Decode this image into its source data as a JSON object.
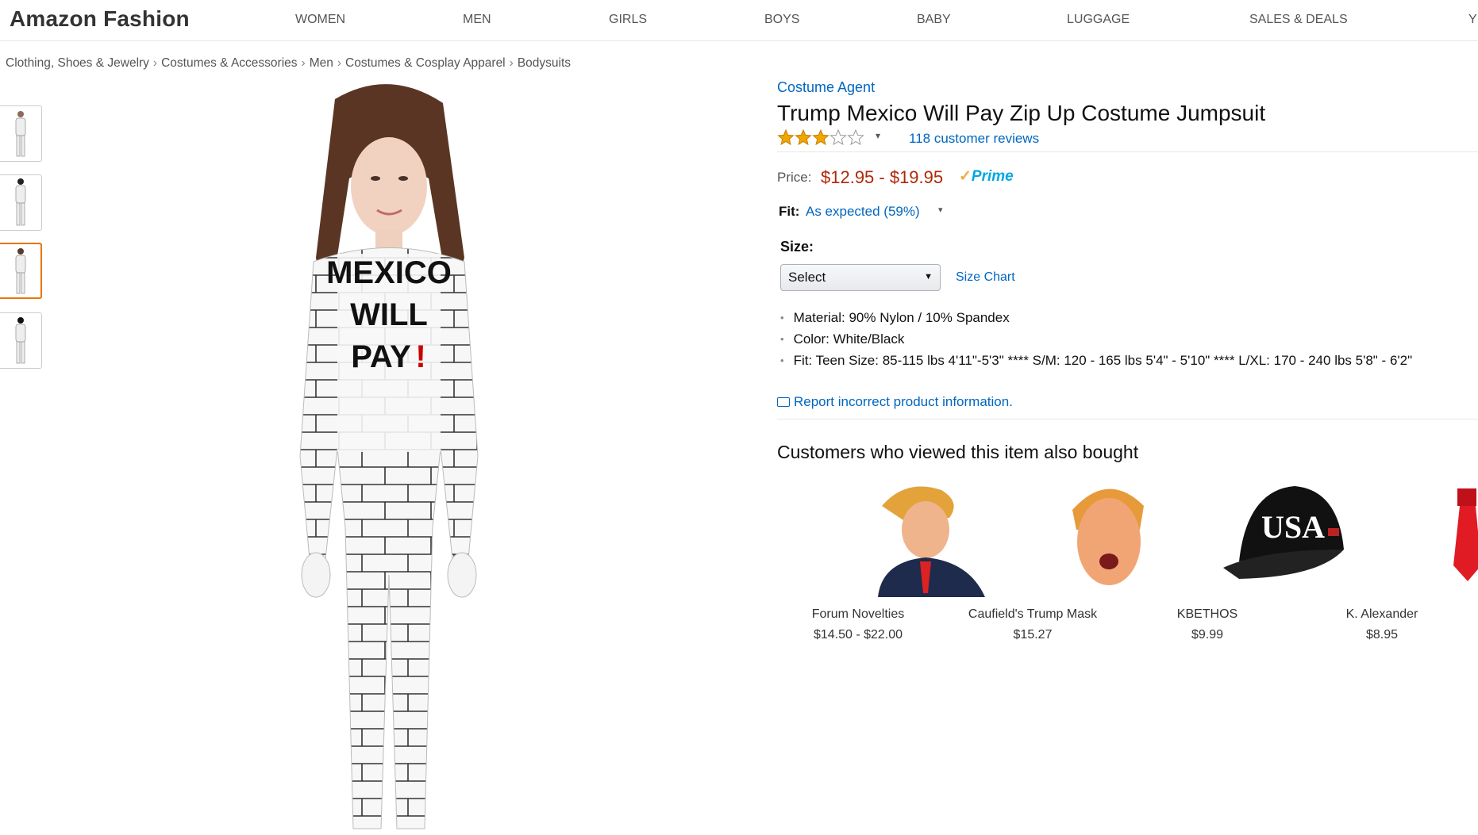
{
  "header": {
    "logo": "Amazon Fashion",
    "nav": [
      "WOMEN",
      "MEN",
      "GIRLS",
      "BOYS",
      "BABY",
      "LUGGAGE",
      "SALES & DEALS",
      "Y"
    ]
  },
  "breadcrumb": [
    "Clothing, Shoes & Jewelry",
    "Costumes & Accessories",
    "Men",
    "Costumes & Cosplay Apparel",
    "Bodysuits"
  ],
  "breadcrumb_sep": "›",
  "product": {
    "brand": "Costume Agent",
    "title": "Trump Mexico Will Pay Zip Up Costume Jumpsuit",
    "rating_stars": 3,
    "rating_max": 5,
    "reviews": "118 customer reviews",
    "price_label": "Price:",
    "price": "$12.95 - $19.95",
    "prime_label": "Prime",
    "fit_label": "Fit:",
    "fit_value": "As expected (59%)",
    "size_label": "Size:",
    "size_select": "Select",
    "size_chart": "Size Chart",
    "bullets": [
      "Material: 90% Nylon / 10% Spandex",
      "Color: White/Black",
      "Fit: Teen Size: 85-115 lbs 4'11\"-5'3\" **** S/M: 120 - 165 lbs 5'4\" - 5'10\" **** L/XL: 170 - 240 lbs 5'8\" - 6'2\""
    ],
    "report": "Report incorrect product information.",
    "image_text": [
      "MEXICO",
      "WILL",
      "PAY",
      "!"
    ]
  },
  "also_bought": {
    "heading": "Customers who viewed this item also bought",
    "items": [
      {
        "name": "Forum Novelties",
        "price": "$14.50 - $22.00"
      },
      {
        "name": "Caufield's Trump Mask",
        "price": "$15.27"
      },
      {
        "name": "KBETHOS",
        "price": "$9.99"
      },
      {
        "name": "K. Alexander",
        "price": "$8.95"
      }
    ],
    "hat_text": "USA"
  },
  "colors": {
    "link": "#0066c0",
    "price": "#b12704",
    "prime": "#00a8e1",
    "star": "#f0a500",
    "thumb_active": "#e77600"
  }
}
